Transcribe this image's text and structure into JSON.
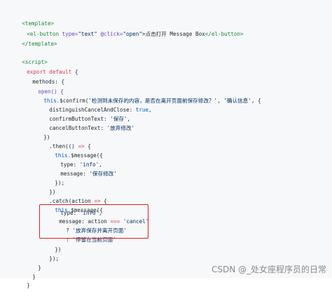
{
  "code": {
    "l01": "<template>",
    "l02_tag": "<el-button",
    "l02_attr1": " type=",
    "l02_val1": "\"text\"",
    "l02_attr2": " @click=",
    "l02_val2": "\"open\"",
    "l02_text": ">点击打开 Message Box",
    "l02_close": "</el-button>",
    "l03": "</template>",
    "l04": "<script>",
    "l05_kw": "export default",
    "l05_rest": " {",
    "l06": "methods: {",
    "l07": "open() {",
    "l08_a": "this.",
    "l08_b": "$confirm(",
    "l08_c": "'检测到未保存的内容，是否在离开页面前保存修改？'",
    "l08_d": ", ",
    "l08_e": "'确认信息'",
    "l08_f": ", {",
    "l09_a": "distinguishCancelAndClose: ",
    "l09_b": "true",
    "l09_c": ",",
    "l10_a": "confirmButtonText: ",
    "l10_b": "'保存'",
    "l10_c": ",",
    "l11_a": "cancelButtonText: ",
    "l11_b": "'放弃修改'",
    "l12": "})",
    "l13_a": ".then(() ",
    "l13_b": "=>",
    "l13_c": " {",
    "l14_a": "this.",
    "l14_b": "$message({",
    "l15_a": "type: ",
    "l15_b": "'info'",
    "l15_c": ",",
    "l16_a": "message: ",
    "l16_b": "'保存修改'",
    "l17": "});",
    "l18": "})",
    "l19_a": ".catch(action ",
    "l19_b": "=>",
    "l19_c": " {",
    "l20_a": "this.",
    "l20_b": "$message({",
    "l21_a": "type: ",
    "l21_b": "'info'",
    "l21_c": ",",
    "l22_a": "message: action ",
    "l22_b": "===",
    "l22_c": " 'cancel'",
    "l23_a": "? ",
    "l23_b": "'放弃保存并离开页面'",
    "l24_a": ": ",
    "l24_b": "'停留在当前页面'",
    "l25": "})",
    "l26": "});",
    "l27": "}",
    "l28": "}",
    "l29": "}"
  },
  "watermark": "CSDN @_处女座程序员的日常"
}
